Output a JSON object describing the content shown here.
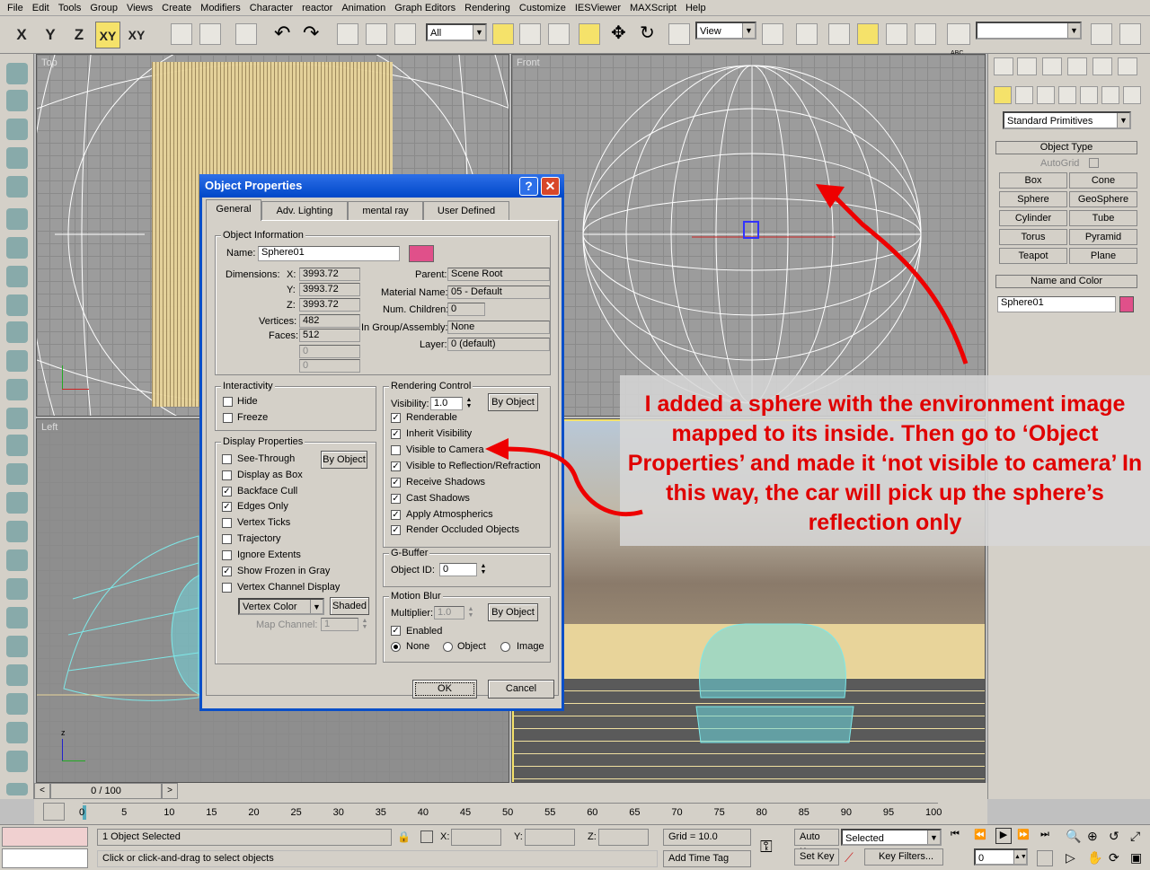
{
  "menu": [
    "File",
    "Edit",
    "Tools",
    "Group",
    "Views",
    "Create",
    "Modifiers",
    "Character",
    "reactor",
    "Animation",
    "Graph Editors",
    "Rendering",
    "Customize",
    "IESViewer",
    "MAXScript",
    "Help"
  ],
  "toolbar": {
    "axis_x": "X",
    "axis_y": "Y",
    "axis_z": "Z",
    "axis_xy": "XY",
    "axis_xy2": "XY",
    "selection_filter": "All",
    "ref_coord": "View",
    "named_selection": "",
    "abc_label": "ABC"
  },
  "viewports": {
    "top": "Top",
    "front": "Front",
    "left": "Left",
    "axis_x": "x",
    "axis_y": "y",
    "axis_z": "z"
  },
  "command_panel": {
    "category": "Standard Primitives",
    "object_type_header": "Object Type",
    "autogrid": "AutoGrid",
    "buttons": [
      "Box",
      "Cone",
      "Sphere",
      "GeoSphere",
      "Cylinder",
      "Tube",
      "Torus",
      "Pyramid",
      "Teapot",
      "Plane"
    ],
    "name_color_header": "Name and Color",
    "object_name": "Sphere01",
    "object_color": "#e0508a"
  },
  "dialog": {
    "title": "Object Properties",
    "help": "?",
    "close": "✕",
    "tabs": [
      "General",
      "Adv. Lighting",
      "mental ray",
      "User Defined"
    ],
    "object_info": {
      "header": "Object Information",
      "name_label": "Name:",
      "name": "Sphere01",
      "dimensions_label": "Dimensions:",
      "x_label": "X:",
      "x": "3993.72",
      "y_label": "Y:",
      "y": "3993.72",
      "z_label": "Z:",
      "z": "3993.72",
      "vertices_label": "Vertices:",
      "vertices": "482",
      "faces_label": "Faces:",
      "faces": "512",
      "blank1": "0",
      "blank2": "0",
      "parent_label": "Parent:",
      "parent": "Scene Root",
      "material_label": "Material Name:",
      "material": "05 - Default",
      "children_label": "Num. Children:",
      "children": "0",
      "group_label": "In Group/Assembly:",
      "group": "None",
      "layer_label": "Layer:",
      "layer": "0 (default)"
    },
    "interactivity": {
      "header": "Interactivity",
      "hide": "Hide",
      "freeze": "Freeze"
    },
    "display": {
      "header": "Display Properties",
      "by_object": "By Object",
      "items": [
        "See-Through",
        "Display as Box",
        "Backface Cull",
        "Edges Only",
        "Vertex Ticks",
        "Trajectory",
        "Ignore Extents",
        "Show Frozen in Gray",
        "Vertex Channel Display"
      ],
      "checked": [
        false,
        false,
        true,
        true,
        false,
        false,
        false,
        true,
        false
      ],
      "vertex_color": "Vertex Color",
      "shaded": "Shaded",
      "map_channel_label": "Map Channel:",
      "map_channel": "1"
    },
    "rendering": {
      "header": "Rendering Control",
      "visibility_label": "Visibility:",
      "visibility": "1.0",
      "by_object": "By Object",
      "items": [
        "Renderable",
        "Inherit Visibility",
        "Visible to Camera",
        "Visible to Reflection/Refraction",
        "Receive Shadows",
        "Cast Shadows",
        "Apply Atmospherics",
        "Render Occluded Objects"
      ],
      "checked": [
        true,
        true,
        false,
        true,
        true,
        true,
        true,
        true
      ]
    },
    "gbuffer": {
      "header": "G-Buffer",
      "object_id_label": "Object ID:",
      "object_id": "0"
    },
    "motion_blur": {
      "header": "Motion Blur",
      "multiplier_label": "Multiplier:",
      "multiplier": "1.0",
      "by_object": "By Object",
      "enabled": "Enabled",
      "none": "None",
      "object": "Object",
      "image": "Image"
    },
    "ok": "OK",
    "cancel": "Cancel"
  },
  "annotation": "I added a sphere with the environment image mapped to its inside. Then go to ‘Object Properties’ and made it ‘not visible to camera’ In this way, the car will pick up the sphere’s reflection only",
  "timeline": {
    "frame": "0 / 100",
    "ticks": [
      "0",
      "5",
      "10",
      "15",
      "20",
      "25",
      "30",
      "35",
      "40",
      "45",
      "50",
      "55",
      "60",
      "65",
      "70",
      "75",
      "80",
      "85",
      "90",
      "95",
      "100"
    ]
  },
  "status": {
    "selected": "1 Object Selected",
    "prompt": "Click or click-and-drag to select objects",
    "x_label": "X:",
    "y_label": "Y:",
    "z_label": "Z:",
    "grid": "Grid = 10.0",
    "add_time_tag": "Add Time Tag",
    "auto_key": "Auto Key",
    "set_key": "Set Key",
    "key_mode": "Selected",
    "key_filters": "Key Filters...",
    "frame": "0"
  }
}
